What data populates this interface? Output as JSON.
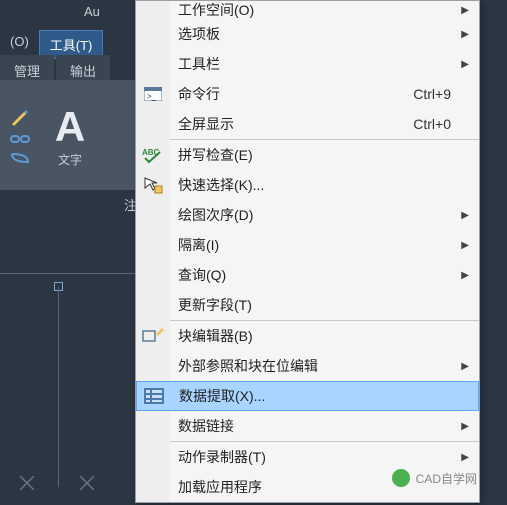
{
  "titlebar": {
    "fragment": "Au"
  },
  "menubar": {
    "items": [
      {
        "label": "(O)"
      },
      {
        "label": "工具(T)"
      }
    ],
    "active_index": 1
  },
  "ribbon_tabs": [
    {
      "label": "管理"
    },
    {
      "label": "输出"
    }
  ],
  "ribbon_panel": {
    "text_label": "文字",
    "ellipsis": "注"
  },
  "menu": {
    "items": [
      {
        "label": "工作空间(O)",
        "icon": null,
        "shortcut": "",
        "submenu": true,
        "partial_top": true
      },
      {
        "label": "选项板",
        "icon": null,
        "shortcut": "",
        "submenu": true
      },
      {
        "label": "工具栏",
        "icon": null,
        "shortcut": "",
        "submenu": true
      },
      {
        "label": "命令行",
        "icon": "cmd-icon",
        "shortcut": "Ctrl+9",
        "submenu": false
      },
      {
        "label": "全屏显示",
        "icon": null,
        "shortcut": "Ctrl+0",
        "submenu": false
      },
      {
        "sep": true
      },
      {
        "label": "拼写检查(E)",
        "icon": "abc-icon",
        "shortcut": "",
        "submenu": false
      },
      {
        "label": "快速选择(K)...",
        "icon": "quickselect-icon",
        "shortcut": "",
        "submenu": false
      },
      {
        "label": "绘图次序(D)",
        "icon": null,
        "shortcut": "",
        "submenu": true
      },
      {
        "label": "隔离(I)",
        "icon": null,
        "shortcut": "",
        "submenu": true
      },
      {
        "label": "查询(Q)",
        "icon": null,
        "shortcut": "",
        "submenu": true
      },
      {
        "label": "更新字段(T)",
        "icon": null,
        "shortcut": "",
        "submenu": false
      },
      {
        "sep": true
      },
      {
        "label": "块编辑器(B)",
        "icon": "blockedit-icon",
        "shortcut": "",
        "submenu": false
      },
      {
        "label": "外部参照和块在位编辑",
        "icon": null,
        "shortcut": "",
        "submenu": true
      },
      {
        "label": "数据提取(X)...",
        "icon": "dataextract-icon",
        "shortcut": "",
        "submenu": false,
        "highlighted": true
      },
      {
        "label": "数据链接",
        "icon": null,
        "shortcut": "",
        "submenu": true
      },
      {
        "sep": true
      },
      {
        "label": "动作录制器(T)",
        "icon": null,
        "shortcut": "",
        "submenu": true
      },
      {
        "label": "加载应用程序",
        "icon": null,
        "shortcut": "",
        "submenu": false,
        "partial_bottom": true
      }
    ]
  },
  "watermark": {
    "text": "CAD自学网"
  },
  "colors": {
    "app_bg": "#2b3642",
    "menu_bg": "#f5f5f5",
    "highlight": "#a8d4ff",
    "ribbon_bg": "#4a5563"
  }
}
